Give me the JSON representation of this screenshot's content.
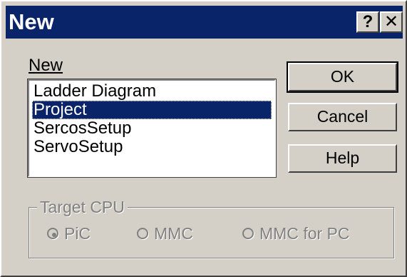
{
  "window": {
    "title": "New",
    "help_glyph": "?",
    "close_glyph": "✕"
  },
  "list": {
    "label": "New",
    "items": [
      "Ladder Diagram",
      "Project",
      "SercosSetup",
      "ServoSetup"
    ],
    "selected": "Project"
  },
  "buttons": {
    "ok": "OK",
    "cancel": "Cancel",
    "help": "Help"
  },
  "target_cpu": {
    "title": "Target CPU",
    "options": [
      {
        "label": "PiC",
        "selected": true
      },
      {
        "label": "MMC",
        "selected": false
      },
      {
        "label": "MMC for PC",
        "selected": false
      }
    ]
  }
}
